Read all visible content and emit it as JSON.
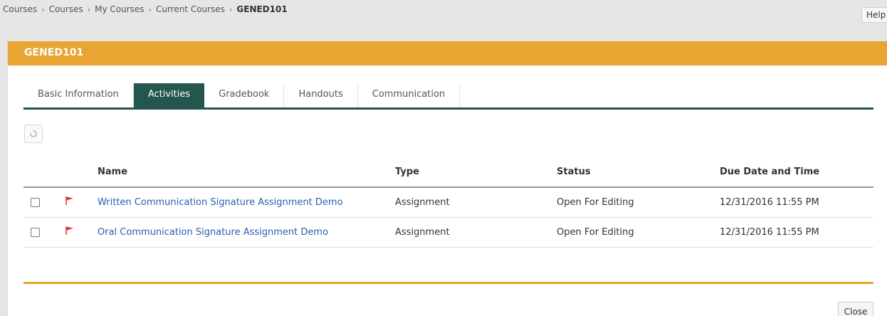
{
  "breadcrumb": {
    "items": [
      "Courses",
      "Courses",
      "My Courses",
      "Current Courses"
    ],
    "current": "GENED101",
    "separator": "›"
  },
  "help_label": "Help",
  "panel": {
    "title": "GENED101"
  },
  "tabs": [
    {
      "label": "Basic Information",
      "active": false
    },
    {
      "label": "Activities",
      "active": true
    },
    {
      "label": "Gradebook",
      "active": false
    },
    {
      "label": "Handouts",
      "active": false
    },
    {
      "label": "Communication",
      "active": false
    }
  ],
  "toolbar": {
    "refresh_icon": "refresh-icon"
  },
  "table": {
    "columns": [
      "Name",
      "Type",
      "Status",
      "Due Date and Time"
    ],
    "rows": [
      {
        "name": "Written Communication Signature Assignment Demo",
        "type": "Assignment",
        "status": "Open For Editing",
        "due": "12/31/2016 11:55 PM"
      },
      {
        "name": "Oral Communication Signature Assignment Demo",
        "type": "Assignment",
        "status": "Open For Editing",
        "due": "12/31/2016 11:55 PM"
      }
    ]
  },
  "close_label": "Close",
  "colors": {
    "accent": "#e8a531",
    "tab_active": "#24554e",
    "link": "#2a5db0",
    "flag": "#d9363e"
  }
}
